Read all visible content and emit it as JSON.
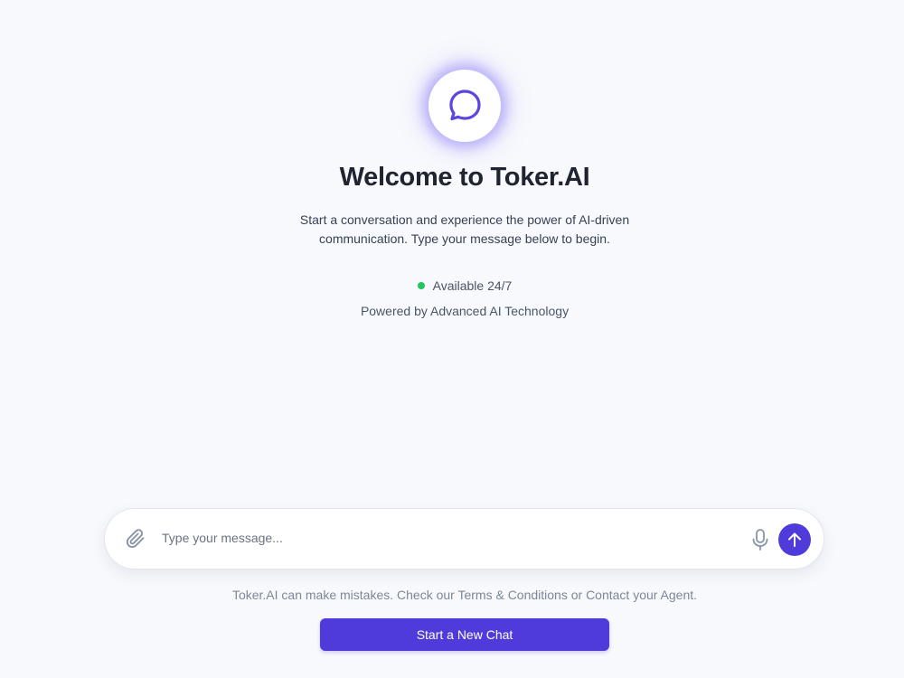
{
  "welcome": {
    "logo_icon": "chat-bubble-icon",
    "title": "Welcome to Toker.AI",
    "subtitle": "Start a conversation and experience the power of AI-driven communication. Type your message below to begin.",
    "status_text": "Available 24/7",
    "status_color": "#22c55e",
    "powered_by": "Powered by Advanced AI Technology"
  },
  "composer": {
    "placeholder": "Type your message...",
    "value": "",
    "attach_icon": "paperclip-icon",
    "mic_icon": "microphone-icon",
    "send_icon": "arrow-up-icon"
  },
  "footer": {
    "disclaimer": "Toker.AI can make mistakes. Check our Terms & Conditions or Contact your Agent.",
    "new_chat_label": "Start a New Chat"
  },
  "colors": {
    "accent": "#4f3bd9",
    "logo_glow": "#7c6cf6",
    "background": "#f8f9fd"
  }
}
